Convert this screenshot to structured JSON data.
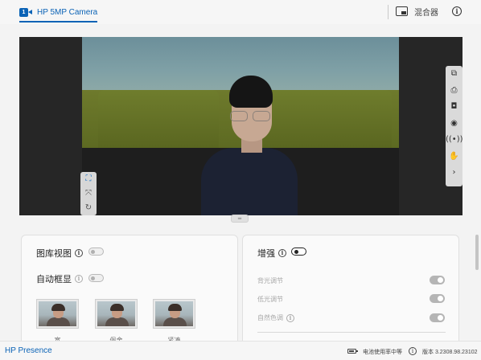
{
  "header": {
    "camera_tab_label": "HP 5MP Camera",
    "camera_icon_glyph": "1",
    "mixer_label": "混合器",
    "info_glyph": "i"
  },
  "preview": {
    "left_tools": [
      "crop-frame-icon",
      "resize-icon",
      "rotate-icon"
    ],
    "right_tools": [
      "pip-icon",
      "print-icon",
      "camera-snapshot-icon",
      "record-icon",
      "broadcast-icon",
      "hand-icon",
      "chevron-right-icon"
    ]
  },
  "left_panel": {
    "gallery_view_label": "图库视图",
    "auto_frame_label": "自动框显",
    "thumbnails": [
      {
        "caption": "宽"
      },
      {
        "caption": "佩舍"
      },
      {
        "caption": "紧凑"
      }
    ]
  },
  "right_panel": {
    "enhance_label": "增强",
    "items": [
      {
        "label": "背光调节"
      },
      {
        "label": "低光调节"
      },
      {
        "label": "自然色调"
      }
    ]
  },
  "footer": {
    "brand": "HP Presence",
    "battery_text": "电池使用率中等",
    "version": "版本 3.2308.98.23102"
  }
}
